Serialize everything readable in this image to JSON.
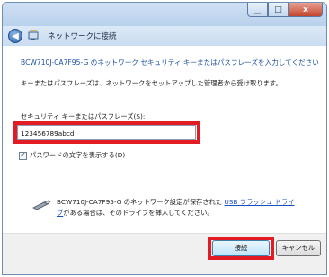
{
  "window": {
    "minimize_icon": "minimize-icon",
    "maximize_icon": "maximize-icon",
    "close_icon": "close-icon",
    "close_glyph": "x"
  },
  "nav": {
    "title": "ネットワークに接続",
    "back_icon": "back-arrow-icon",
    "network_icon": "network-icon"
  },
  "main": {
    "heading": "BCW710J-CA7F95-G のネットワーク セキュリティ キーまたはパスフレーズを入力してください",
    "description": "キーまたはパスフレーズは、ネットワークをセットアップした管理者から受け取ります。",
    "field_label": "セキュリティ キーまたはパスフレーズ(S):",
    "field_value": "123456789abcd",
    "show_chars_label": "パスワードの文字を表示する(D)",
    "show_chars_checked": true,
    "usb_text_prefix": "BCW710J-CA7F95-G のネットワーク設定が保存された",
    "usb_link_part1": "USB フラッシュ ドライ",
    "usb_link_part2": "ブ",
    "usb_text_suffix": "がある場合は、そのドライブを挿入してください。",
    "usb_icon": "usb-drive-icon"
  },
  "footer": {
    "connect_label": "接続",
    "cancel_label": "キャンセル"
  },
  "colors": {
    "heading": "#1e50a0",
    "highlight": "#e31b23",
    "link": "#1a4fc0"
  }
}
